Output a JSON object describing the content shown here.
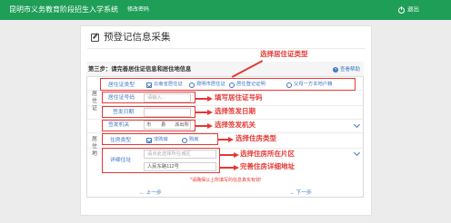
{
  "header": {
    "title": "昆明市义务教育阶段招生入学系统",
    "logout_link": "修改密码",
    "logout_button": "退出"
  },
  "page": {
    "title": "预登记信息采集",
    "step_title": "第三步：请完善居住证信息和居住地信息",
    "help_link": "查看帮助"
  },
  "residence_permit": {
    "group_label": "居住证",
    "type_label": "居住证类型",
    "type_options": [
      {
        "label": "云南省居住证",
        "checked": true
      },
      {
        "label": "昆明市居住证",
        "checked": false
      },
      {
        "label": "居住登记证明",
        "checked": false
      },
      {
        "label": "父母一方本地户籍",
        "checked": false
      }
    ],
    "number_label": "居住证号码",
    "number_placeholder": "请输入...",
    "date_label": "签发日期",
    "authority_label": "签发机关",
    "authority_segments": [
      "市",
      "县",
      "派出所"
    ]
  },
  "residence_info": {
    "group_label": "居住地",
    "housing_label": "住房类型",
    "housing_options": [
      {
        "label": "非购房",
        "checked": true
      },
      {
        "label": "购房",
        "checked": false
      }
    ],
    "address_label": "详细住址",
    "district_placeholder": "请点此选择所在城区",
    "address_value": "人民东路112号"
  },
  "notice": "*请确保以上所填写的信息真实有效!",
  "navigation": {
    "prev": "上一步",
    "next": "下一步"
  },
  "annotations": {
    "type": "选择居住证类型",
    "number": "填写居住证号码",
    "date": "选择签发日期",
    "authority": "选择签发机关",
    "housing": "选择住房类型",
    "district": "选择住房所在片区",
    "address": "完善住房详细地址"
  },
  "colors": {
    "header_green": "#1e9e57",
    "link_blue": "#3a78c3",
    "annotation_red": "#e53935"
  }
}
